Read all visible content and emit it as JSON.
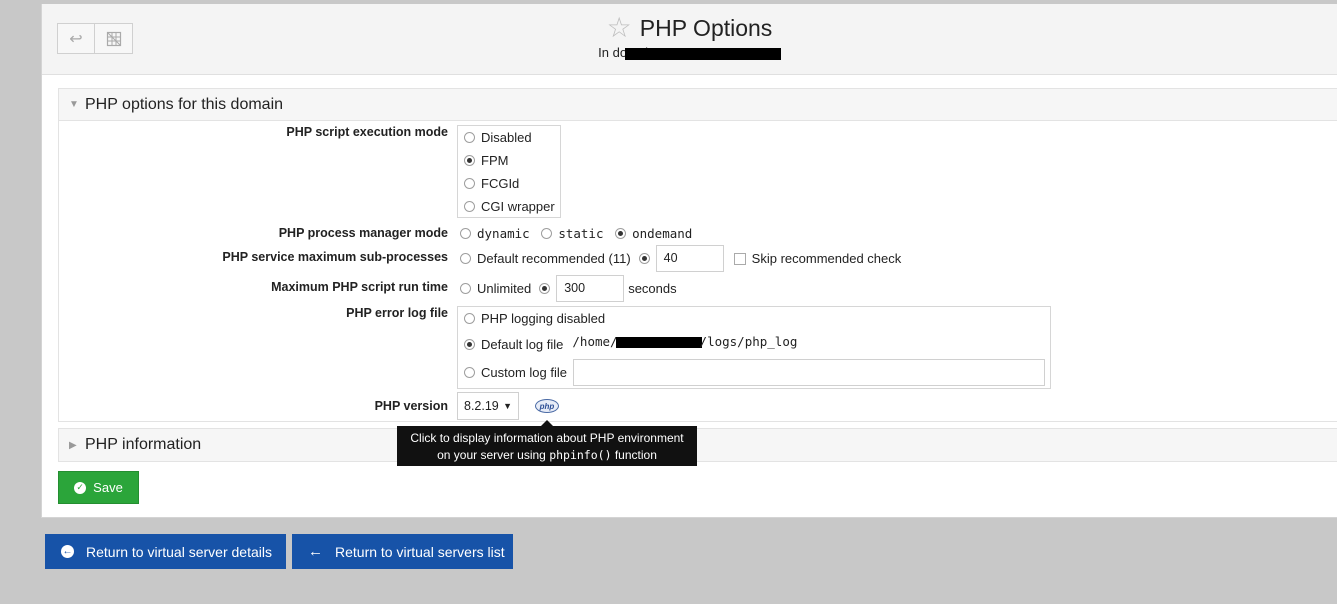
{
  "header": {
    "title": "PHP Options",
    "subtitle_prefix": "In domain"
  },
  "icons": {
    "back": "return-arrow-icon",
    "grid": "grid-off-icon",
    "star": "star-outline-icon",
    "php": "php-logo-icon"
  },
  "sections": {
    "options_title": "PHP options for this domain",
    "info_title": "PHP information"
  },
  "form": {
    "exec_mode": {
      "label": "PHP script execution mode",
      "options": [
        "Disabled",
        "FPM",
        "FCGId",
        "CGI wrapper"
      ],
      "selected": "FPM"
    },
    "pm_mode": {
      "label": "PHP process manager mode",
      "options": [
        "dynamic",
        "static",
        "ondemand"
      ],
      "selected": "ondemand"
    },
    "max_sub": {
      "label": "PHP service maximum sub-processes",
      "default_label": "Default recommended (11)",
      "value": "40",
      "skip_label": "Skip recommended check"
    },
    "max_time": {
      "label": "Maximum PHP script run time",
      "unlimited_label": "Unlimited",
      "value": "300",
      "unit": "seconds"
    },
    "error_log": {
      "label": "PHP error log file",
      "disabled_label": "PHP logging disabled",
      "default_label": "Default log file",
      "default_path_prefix": "/home/",
      "default_path_suffix": "/logs/php_log",
      "custom_label": "Custom log file",
      "custom_value": ""
    },
    "version": {
      "label": "PHP version",
      "value": "8.2.19",
      "tooltip_line1": "Click to display information about PHP environment",
      "tooltip_line2_prefix": "on your server using",
      "tooltip_code": "phpinfo()",
      "tooltip_line2_suffix": "function"
    }
  },
  "buttons": {
    "save": "Save",
    "return_details": "Return to virtual server details",
    "return_list": "Return to virtual servers list"
  },
  "colors": {
    "save": "#2ba53a",
    "nav": "#1753a8"
  }
}
